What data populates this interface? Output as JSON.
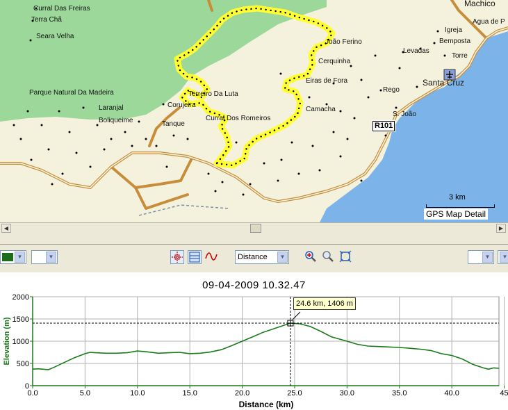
{
  "map": {
    "places": [
      {
        "name": "Curral Das Freiras"
      },
      {
        "name": "Terra Chã"
      },
      {
        "name": "Seara Velha"
      },
      {
        "name": "Parque Natural Da Madeira"
      },
      {
        "name": "Laranjal"
      },
      {
        "name": "Boliqueime"
      },
      {
        "name": "Terreiro Da Luta"
      },
      {
        "name": "Corujeira"
      },
      {
        "name": "Tanque"
      },
      {
        "name": "Curral Dos Romeiros"
      },
      {
        "name": "João Ferino"
      },
      {
        "name": "Cerquinha"
      },
      {
        "name": "Eiras de Fora"
      },
      {
        "name": "Camacha"
      },
      {
        "name": "Machico"
      },
      {
        "name": "Agua de P"
      },
      {
        "name": "Igreja"
      },
      {
        "name": "Bemposta"
      },
      {
        "name": "Levadas"
      },
      {
        "name": "Torre"
      },
      {
        "name": "Santa Cruz"
      },
      {
        "name": "Rego"
      },
      {
        "name": "S. João"
      }
    ],
    "road_label": "R101",
    "scale_text": "3 km",
    "detail_label": "GPS Map Detail",
    "colors": {
      "land": "#f4f2dc",
      "park": "#9bd89a",
      "sea": "#7cb3e8",
      "road": "#c88d3a",
      "track": "#ffff33"
    }
  },
  "toolbar": {
    "left_color_swatch": "#1a6e1a",
    "x_axis_select": "Distance",
    "icons": [
      "crosshair-icon",
      "fit-graph-icon",
      "curve-icon",
      "zoom-in-icon",
      "zoom-out-icon",
      "zoom-extent-icon"
    ]
  },
  "chart_title": "09-04-2009 10.32.47",
  "tooltip": "24.6 km, 1406 m",
  "chart_data": {
    "type": "line",
    "title": "09-04-2009 10.32.47",
    "xlabel": "Distance (km)",
    "ylabel": "Elevation (m)",
    "xlim": [
      0,
      44.5
    ],
    "ylim": [
      0,
      2000
    ],
    "xticks": [
      "0.0",
      "5.0",
      "10.0",
      "15.0",
      "20.0",
      "25.0",
      "30.0",
      "35.0",
      "40.0",
      "45"
    ],
    "yticks": [
      "0",
      "500",
      "1000",
      "1500",
      "2000"
    ],
    "grid": true,
    "series": [
      {
        "color": "#1a7a1a",
        "x": [
          0,
          0.5,
          1,
          1.5,
          2,
          3,
          4,
          5,
          5.5,
          6,
          7,
          8,
          9,
          10,
          11,
          12,
          13,
          14,
          15,
          16,
          17,
          18,
          19,
          20,
          21,
          22,
          23,
          24,
          24.6,
          25.5,
          26.5,
          27.5,
          28.5,
          30,
          31,
          32,
          33,
          34,
          35,
          36,
          37,
          38,
          39,
          40,
          41,
          42,
          43,
          43.5,
          44,
          44.5
        ],
        "y": [
          370,
          380,
          370,
          360,
          410,
          520,
          630,
          720,
          750,
          740,
          730,
          730,
          740,
          780,
          760,
          730,
          740,
          750,
          720,
          730,
          760,
          810,
          900,
          1000,
          1100,
          1200,
          1280,
          1360,
          1406,
          1390,
          1330,
          1220,
          1100,
          1000,
          930,
          890,
          880,
          870,
          860,
          840,
          820,
          790,
          720,
          680,
          600,
          480,
          400,
          370,
          400,
          390
        ]
      }
    ],
    "cursor": {
      "x": 24.6,
      "y": 1406
    }
  }
}
